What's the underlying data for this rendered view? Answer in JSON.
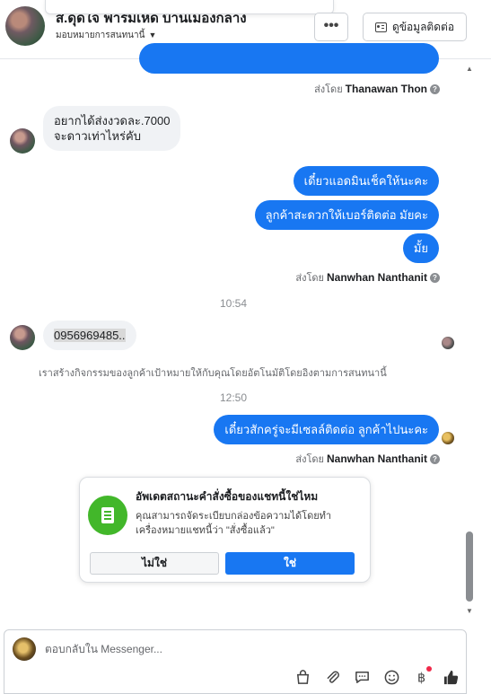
{
  "header": {
    "title": "ส.ดุดใจ ฟาร์มเห็ด บ้านเมืองกลาง",
    "subtitle": "มอบหมายการสนทนานี้",
    "more_label": "•••",
    "contact_label": "ดูข้อมูลติดต่อ"
  },
  "messages": {
    "sent_by_prefix": "ส่งโดย",
    "sender_1": "Thanawan Thon",
    "incoming_1_line1": "อยากได้ส่งงวดละ.7000",
    "incoming_1_line2": "จะดาวเท่าไหร่คับ",
    "out_1": "เดี๋ยวแอดมินเช็คให้นะคะ",
    "out_2": "ลูกค้าสะดวกให้เบอร์ติดต่อ มัยคะ",
    "out_3": "มั้ย",
    "sender_2": "Nanwhan Nanthanit",
    "time_1": "10:54",
    "incoming_2": "0956969485..",
    "system_note": "เราสร้างกิจกรรมของลูกค้าเป้าหมายให้กับคุณโดยอัตโนมัติโดยอิงตามการสนทนานี้",
    "time_2": "12:50",
    "out_4": "เดี๋ยวสักครู่จะมีเซลล์ติดต่อ ลูกค้าไปนะคะ",
    "sender_3": "Nanwhan Nanthanit"
  },
  "card": {
    "title": "อัพเดตสถานะคำสั่งซื้อของแชทนี้ใช่ไหม",
    "body": "คุณสามารถจัดระเบียบกล่องข้อความได้โดยทำเครื่องหมายแชทนี้ว่า \"สั่งซื้อแล้ว\"",
    "no_label": "ไม่ใช่",
    "yes_label": "ใช่"
  },
  "composer": {
    "placeholder": "ตอบกลับใน Messenger...",
    "icons": [
      "shopping-bag-icon",
      "paperclip-icon",
      "saved-reply-icon",
      "emoji-icon",
      "payment-icon",
      "like-icon"
    ]
  },
  "colors": {
    "outgoing_bubble": "#1877f2",
    "incoming_bubble": "#f0f2f5",
    "card_icon": "#42b72a",
    "notification_dot": "#f02849"
  }
}
